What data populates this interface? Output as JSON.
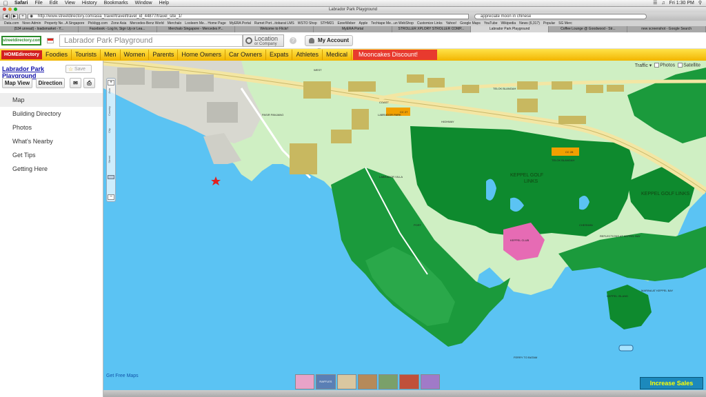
{
  "menubar": {
    "apple": "",
    "items": [
      "Safari",
      "File",
      "Edit",
      "View",
      "History",
      "Bookmarks",
      "Window",
      "Help"
    ],
    "clock": "Fri 1:30 PM"
  },
  "window": {
    "title": "Labrador Park Playground"
  },
  "toolbar": {
    "url": "http://www.streetdirectory.com/asia_travel/travel/travel_id_44877/travel_site_1/",
    "search": "appreciate moon in chinese"
  },
  "bookmarks": [
    "Data.com",
    "Novo Admin",
    "Property Ne...A Singapore",
    "Pickbgg.com",
    "Zone Asia",
    "Mercedes-Benz World",
    "Merchalo",
    "Looleem Me... Home Page",
    "MyERA Portal",
    "Rumet Port...itobarat LMS",
    "WSTO Shop",
    "STHM21",
    "EzeeWeber",
    "Apple",
    "Techtape Me...un WebShop",
    "Customize Links",
    "Yahoo!",
    "Google Maps",
    "YouTube",
    "Wikipedia",
    "News (6,317)",
    "Popular",
    "SG Merc"
  ],
  "tabs": [
    {
      "label": "(534 unread) - loadsmarket - Y..."
    },
    {
      "label": "Facebook - Log In, Sign Up or Lea..."
    },
    {
      "label": "Merchalo Singapore - Mercedes P..."
    },
    {
      "label": "Welcome to Flickr!"
    },
    {
      "label": "MyERA Portal"
    },
    {
      "label": "STROLLER XPLORY STROLLER COMP..."
    },
    {
      "label": "Labrador Park Playground",
      "active": true
    },
    {
      "label": "Coffee Lounge @ Goodwood - Str..."
    },
    {
      "label": "new screenshot - Google Search"
    }
  ],
  "site": {
    "logo": "streetdirectory.com",
    "search_value": "Labrador Park Playground",
    "location_btn": "Location",
    "location_sub": "or Company",
    "help": "?",
    "account": "My Account"
  },
  "categories": {
    "home": "HOMEdirectory",
    "items": [
      "Foodies",
      "Tourists",
      "Men",
      "Women",
      "Parents",
      "Home Owners",
      "Car Owners",
      "Expats",
      "Athletes",
      "Medical"
    ],
    "promo": "Mooncakes Discount!"
  },
  "sidebar": {
    "title": "Labrador Park Playground",
    "save": "Save",
    "map_view": "Map View",
    "direction": "Direction",
    "nav": [
      {
        "label": "Map",
        "active": true
      },
      {
        "label": "Building Directory"
      },
      {
        "label": "Photos"
      },
      {
        "label": "What's Nearby"
      },
      {
        "label": "Get Tips"
      },
      {
        "label": "Getting Here"
      }
    ]
  },
  "map": {
    "options": [
      "Traffic",
      "Photos",
      "Satellite"
    ],
    "zoom_labels": [
      "Asia",
      "Country",
      "City",
      "Street"
    ],
    "free_maps": "Get Free Maps",
    "increase_sales": "Increase Sales",
    "labels": {
      "keppel_golf": "KEPPEL GOLF",
      "links": "LINKS",
      "keppel_golf_links_east": "KEPPEL GOLF LINKS",
      "labrador_park": "LABRADOR PARK",
      "telok_blangah": "TELOK BLANGAH",
      "station_a": "CC 27",
      "station_b": "CC 28",
      "coast": "COAST",
      "west": "WEST",
      "highway": "HIGHWAY",
      "labrador_villa": "LABRADOR VILLA",
      "telok_blangah_rd": "TELOK BLANGAH",
      "pasir_panjang": "PASIR PANJANG",
      "port": "PORT",
      "cherimin": "CHERIMIN",
      "reflections": "REFLECTIONS AT KEPPEL BAY",
      "keppel_island": "KEPPEL ISLAND",
      "marina_at_keppel": "MARINA AT KEPPEL BAY",
      "ferry": "FERRY TO BATAM",
      "keppel_club": "KEPPEL CLUB"
    },
    "ads": [
      "",
      "RAFFLES",
      "",
      "",
      "",
      "",
      ""
    ]
  },
  "colors": {
    "water": "#5bc3f3",
    "park": "#1b9a3c",
    "golf": "#0e8a2e",
    "land": "#cfefc3",
    "road": "#f3e6a3",
    "building": "#c8b860",
    "accent": "#f2b500"
  }
}
